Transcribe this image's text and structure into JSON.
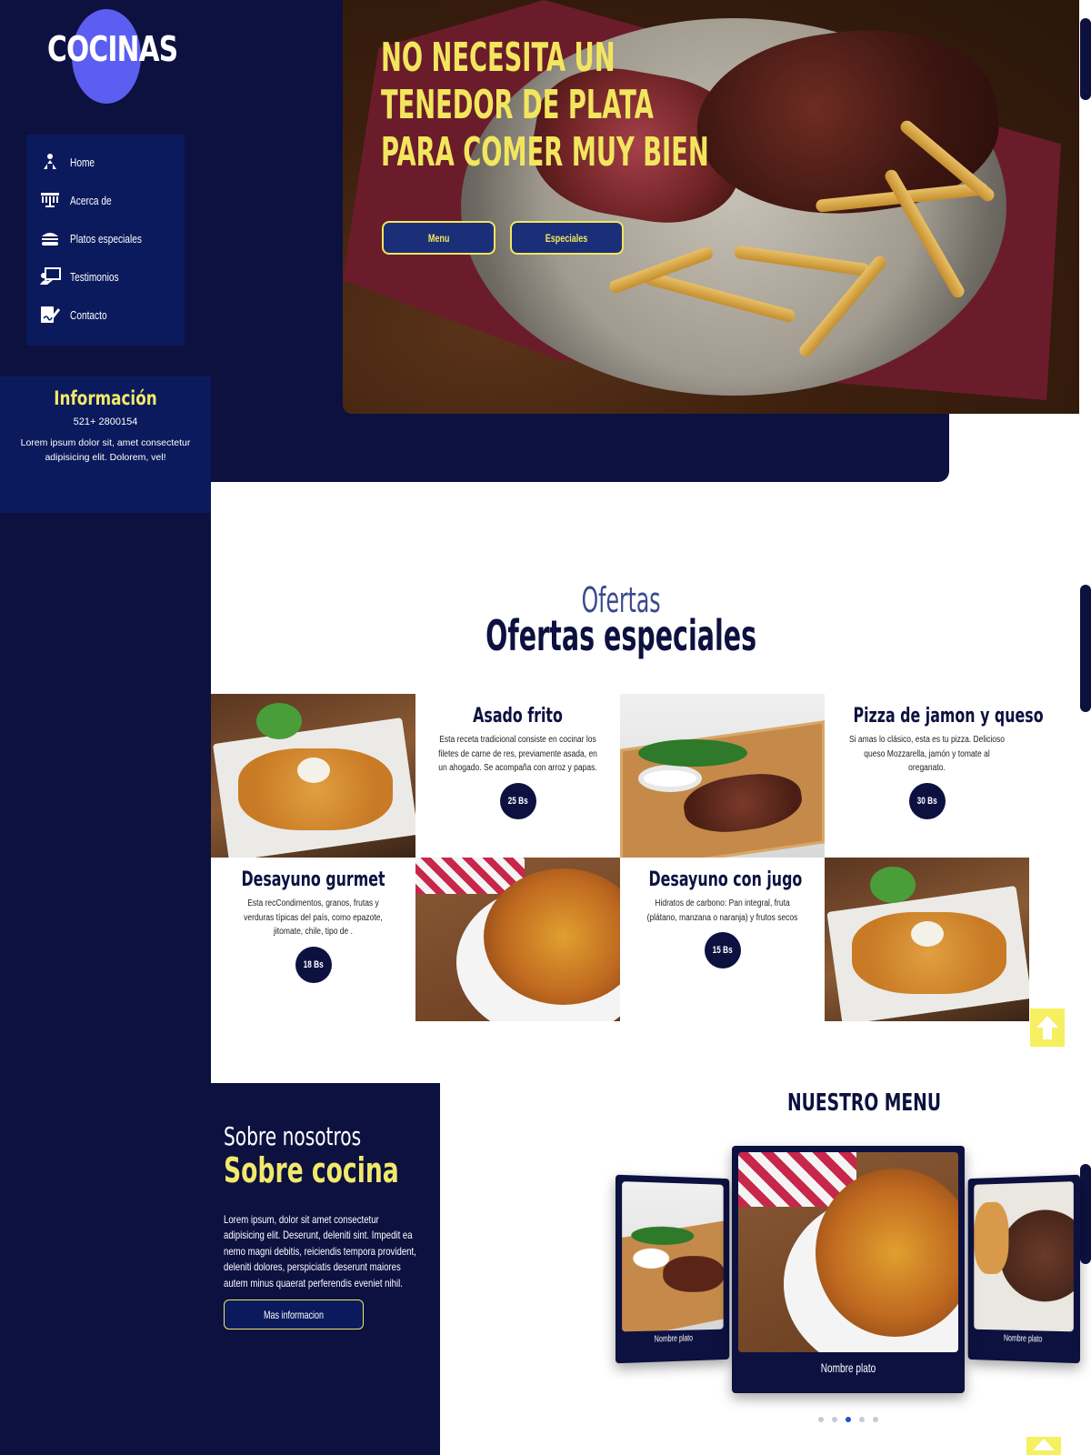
{
  "brand": {
    "logo_text": "COCINAS"
  },
  "nav": {
    "items": [
      {
        "label": "Home",
        "icon": "home-icon"
      },
      {
        "label": "Acerca de",
        "icon": "menorah-icon"
      },
      {
        "label": "Platos especiales",
        "icon": "burger-icon"
      },
      {
        "label": "Testimonios",
        "icon": "chalkboard-teacher-icon"
      },
      {
        "label": "Contacto",
        "icon": "signature-icon"
      }
    ]
  },
  "info": {
    "title": "Información",
    "phone": "521+ 2800154",
    "text": "Lorem ipsum dolor sit, amet consectetur adipisicing elit. Dolorem, vel!"
  },
  "hero": {
    "headline": [
      "NO NECESITA UN",
      "TENEDOR DE PLATA",
      "PARA COMER MUY BIEN"
    ],
    "btn_menu": "Menu",
    "btn_especiales": "Especiales"
  },
  "offers": {
    "subtitle": "Ofertas",
    "title": "Ofertas especiales",
    "items": [
      {
        "name": "Asado frito",
        "desc": "Esta receta tradicional consiste en cocinar los filetes de carne de res, previamente asada, en un ahogado. Se acompaña con arroz y papas.",
        "price": "25 Bs"
      },
      {
        "name": "Pizza de jamon y queso",
        "desc": "Si amas lo clásico, esta es tu pizza. Delicioso queso Mozzarella, jamón y tomate al oreganato.",
        "price": "30 Bs"
      },
      {
        "name": "Desayuno gurmet",
        "desc": "Esta recCondimentos, granos, frutas y verduras típicas del país, como epazote, jitomate, chile, tipo de .",
        "price": "18 Bs"
      },
      {
        "name": "Desayuno con jugo",
        "desc": "Hidratos de carbono: Pan integral, fruta (plátano, manzana o naranja) y frutos secos",
        "price": "15 Bs"
      }
    ]
  },
  "about": {
    "subtitle": "Sobre nosotros",
    "title": "Sobre cocina",
    "text": "Lorem ipsum, dolor sit amet consectetur adipisicing elit. Deserunt, deleniti sint. Impedit ea nemo magni debitis, reiciendis tempora provident, deleniti dolores, perspiciatis deserunt maiores autem minus quaerat perferendis eveniet nihil.",
    "button": "Mas informacion"
  },
  "menu": {
    "title": "NUESTRO MENU",
    "cards": [
      {
        "name": "Nombre plato"
      },
      {
        "name": "Nombre plato"
      },
      {
        "name": "Nombre plato"
      }
    ],
    "dots": 5,
    "active_dot": 3
  },
  "colors": {
    "navy": "#0c1140",
    "nav_blue": "#0a1a5c",
    "yellow": "#f2e86a",
    "logo_purple": "#5b5ef0"
  }
}
